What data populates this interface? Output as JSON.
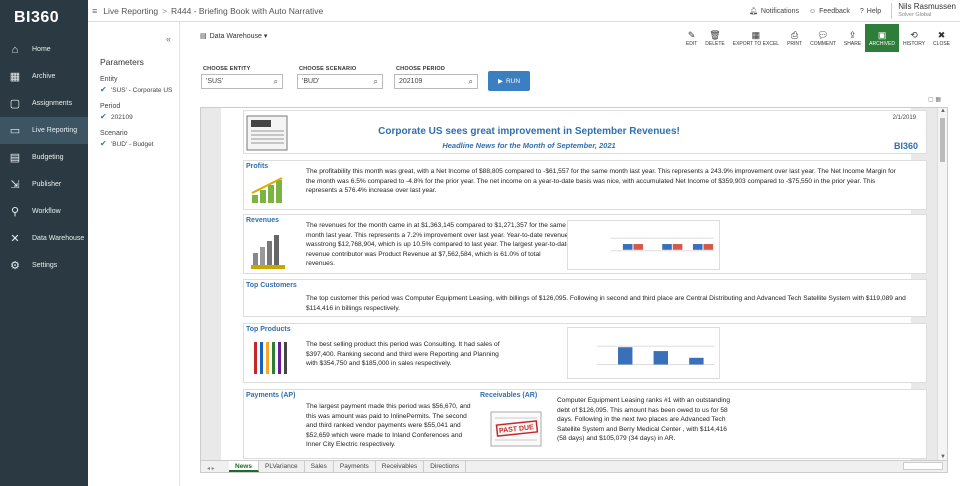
{
  "app": {
    "logo": "BI360"
  },
  "sidebar": {
    "items": [
      {
        "label": "Home",
        "icon": "home-icon"
      },
      {
        "label": "Archive",
        "icon": "archive-icon"
      },
      {
        "label": "Assignments",
        "icon": "assignments-icon"
      },
      {
        "label": "Live Reporting",
        "icon": "live-reporting-icon",
        "active": true
      },
      {
        "label": "Budgeting",
        "icon": "budgeting-icon"
      },
      {
        "label": "Publisher",
        "icon": "publisher-icon"
      },
      {
        "label": "Workflow",
        "icon": "workflow-icon"
      },
      {
        "label": "Data Warehouse",
        "icon": "data-warehouse-icon"
      },
      {
        "label": "Settings",
        "icon": "settings-icon"
      }
    ]
  },
  "topbar": {
    "menu_glyph": "≡",
    "crumb_root": "Live Reporting",
    "crumb_sep": ">",
    "crumb_page": "R444 - Briefing Book with Auto Narrative",
    "notifications": "Notifications",
    "feedback": "Feedback",
    "help": "Help",
    "user_name": "Nils Rasmussen",
    "user_company": "Solver Global"
  },
  "params": {
    "title": "Parameters",
    "collapse": "«",
    "entity_label": "Entity",
    "entity_value": "'SUS' - Corporate US",
    "period_label": "Period",
    "period_value": "202109",
    "scenario_label": "Scenario",
    "scenario_value": "'BUD' - Budget"
  },
  "toolbar": {
    "datasource": "Data Warehouse",
    "tools": [
      "EDIT",
      "DELETE",
      "EXPORT TO EXCEL",
      "PRINT",
      "COMMENT",
      "SHARE",
      "ARCHIVED",
      "HISTORY",
      "CLOSE"
    ]
  },
  "choose": {
    "entity_label": "CHOOSE ENTITY",
    "entity_value": "'SUS'",
    "scenario_label": "CHOOSE SCENARIO",
    "scenario_value": "'BUD'",
    "period_label": "CHOOSE PERIOD",
    "period_value": "202109",
    "run_label": "RUN"
  },
  "report": {
    "date": "2/1/2019",
    "title": "Corporate US sees great improvement in September Revenues!",
    "subtitle": "Headline News for the Month of September, 2021",
    "logo": "BI360",
    "profits_title": "Profits",
    "profits_text": "The profitability this month was great, with a Net Income of $88,805 compared to -$61,557 for the same month last year. This represents a 243.9% improvement over last year. The Net Income Margin for the month was 6.5% compared to -4.8% for the prior year. The net income on a year-to-date basis was nice, with accumulated Net Income of $359,903 compared to -$75,550 in the prior year. This represents a 576.4% increase over last year.",
    "revenues_title": "Revenues",
    "revenues_text": "The revenues for the month came in at $1,363,145 compared to $1,271,357 for the same month last year. This represents a 7.2% improvement over last year. Year-to-date revenue wasstrong $12,768,904, which is up 10.5% compared to last year. The largest year-to-date revenue contributor was Product Revenue at $7,562,584, which is  61.0% of total revenues.",
    "customers_title": "Top Customers",
    "customers_text": "The top customer this period was Computer Equipment Leasing, with billings of $126,095. Following in second and third place are Central Distributing and Advanced Tech Satellite System with $119,089 and $114,416 in billings respectively.",
    "products_title": "Top Products",
    "products_text": "The best selling product this period was Consulting. It had sales of $397,400. Ranking second and third were Reporting and Planning with $354,750 and $185,000 in sales respectively.",
    "ap_title": "Payments (AP)",
    "ap_text": "The largest payment made this period was $56,670, and this was amount was paid to InlinePermits. The second and third ranked vendor payments were $55,041 and $52,659 which were made to Inland Conferences and Inner City Electric respectively.",
    "ar_title": "Receivables (AR)",
    "ar_text": "Computer Equipment Leasing ranks #1 with an outstanding debt of $126,095. This amount has been owed to us for 58 days. Following in the next two places are Advanced Tech Satellite System and Berry Medical Center , with $114,416 (58 days) and $105,079 (34 days) in AR.",
    "stamp_text": "PAST DUE"
  },
  "sheet_tabs": [
    "News",
    "PLVariance",
    "Sales",
    "Payments",
    "Receivables",
    "Directions"
  ],
  "colors": {
    "sidebar_bg": "#2b3a42",
    "accent_blue": "#2f6fb0",
    "active_green": "#2f7d3b",
    "run_blue": "#3b7fc2"
  }
}
